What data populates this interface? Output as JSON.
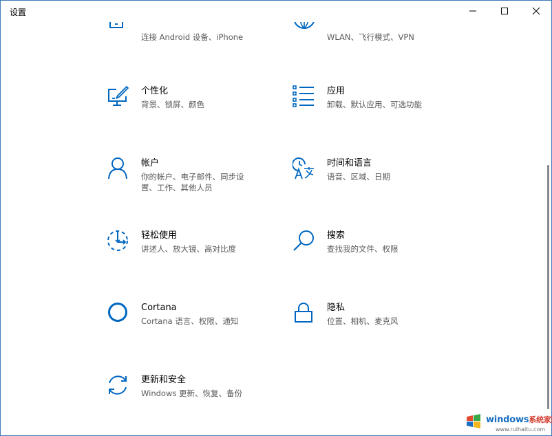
{
  "window": {
    "title": "设置",
    "accent": "#0067c0"
  },
  "tiles": [
    {
      "id": "phone",
      "icon": "phone-icon",
      "title": "",
      "desc": [
        "连接 Android 设备、iPhone"
      ]
    },
    {
      "id": "network",
      "icon": "globe-icon",
      "title": "",
      "desc": [
        "WLAN、飞行模式、VPN"
      ]
    },
    {
      "id": "personalization",
      "icon": "personalization-icon",
      "title": "个性化",
      "desc": [
        "背景、锁屏、颜色"
      ]
    },
    {
      "id": "apps",
      "icon": "apps-list-icon",
      "title": "应用",
      "desc": [
        "卸载、默认应用、可选功能"
      ]
    },
    {
      "id": "accounts",
      "icon": "person-icon",
      "title": "帐户",
      "desc": [
        "你的帐户、电子邮件、同步设",
        "置、工作、其他人员"
      ]
    },
    {
      "id": "time-language",
      "icon": "time-language-icon",
      "title": "时间和语言",
      "desc": [
        "语音、区域、日期"
      ]
    },
    {
      "id": "ease-of-access",
      "icon": "ease-of-access-icon",
      "title": "轻松使用",
      "desc": [
        "讲述人、放大镜、高对比度"
      ]
    },
    {
      "id": "search",
      "icon": "search-icon",
      "title": "搜索",
      "desc": [
        "查找我的文件、权限"
      ]
    },
    {
      "id": "cortana",
      "icon": "cortana-icon",
      "title": "Cortana",
      "desc": [
        "Cortana 语言、权限、通知"
      ]
    },
    {
      "id": "privacy",
      "icon": "lock-icon",
      "title": "隐私",
      "desc": [
        "位置、相机、麦克风"
      ]
    },
    {
      "id": "update-security",
      "icon": "sync-icon",
      "title": "更新和安全",
      "desc": [
        "Windows 更新、恢复、备份"
      ]
    }
  ],
  "watermark": {
    "brand": "windows",
    "brand_zh": "系统家园",
    "url": "www.ruihaitu.com"
  }
}
